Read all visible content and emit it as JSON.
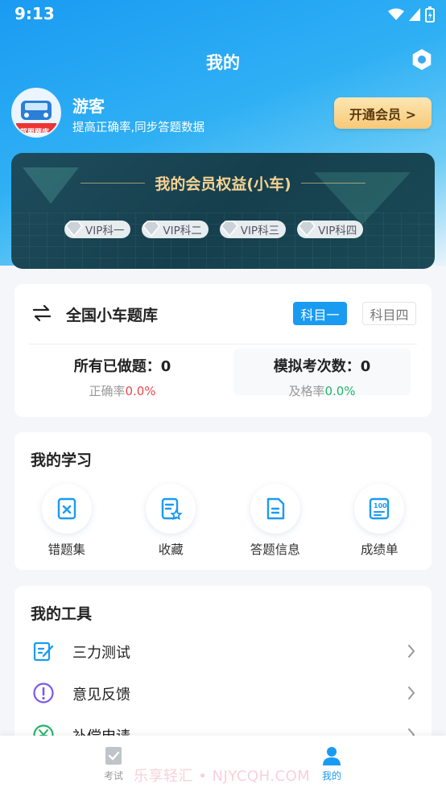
{
  "status": {
    "time": "9:13"
  },
  "header": {
    "title": "我的"
  },
  "user": {
    "name": "游客",
    "subtitle": "提高正确率,同步答题数据",
    "avatar_text": "驾照题库"
  },
  "vip_button": {
    "label": "开通会员 >"
  },
  "vip_card": {
    "title": "我的会员权益(小车)",
    "chips": [
      "VIP科一",
      "VIP科二",
      "VIP科三",
      "VIP科四"
    ]
  },
  "bank": {
    "title": "全国小车题库",
    "tabs": [
      "科目一",
      "科目四"
    ],
    "done_label": "所有已做题：0",
    "accuracy_label": "正确率",
    "accuracy_value": "0.0%",
    "exam_label": "模拟考次数：0",
    "pass_label": "及格率",
    "pass_value": "0.0%"
  },
  "study": {
    "title": "我的学习",
    "items": [
      {
        "label": "错题集",
        "icon": "wrong-book-icon"
      },
      {
        "label": "收藏",
        "icon": "favorite-icon"
      },
      {
        "label": "答题信息",
        "icon": "answer-info-icon"
      },
      {
        "label": "成绩单",
        "icon": "score-sheet-icon"
      }
    ]
  },
  "tools": {
    "title": "我的工具",
    "items": [
      {
        "label": "三力测试",
        "icon": "test-edit-icon"
      },
      {
        "label": "意见反馈",
        "icon": "feedback-icon"
      },
      {
        "label": "补偿申请",
        "icon": "yuan-icon"
      }
    ]
  },
  "tabbar": {
    "items": [
      {
        "label": "考试",
        "icon": "exam-icon"
      },
      {
        "label": "我的",
        "icon": "profile-icon"
      }
    ]
  },
  "watermark": "乐享轻汇 • NJYCQH.COM",
  "colors": {
    "primary": "#1a9bf2",
    "gold": "#f5d293",
    "red": "#e9474a",
    "green": "#23b56a"
  }
}
